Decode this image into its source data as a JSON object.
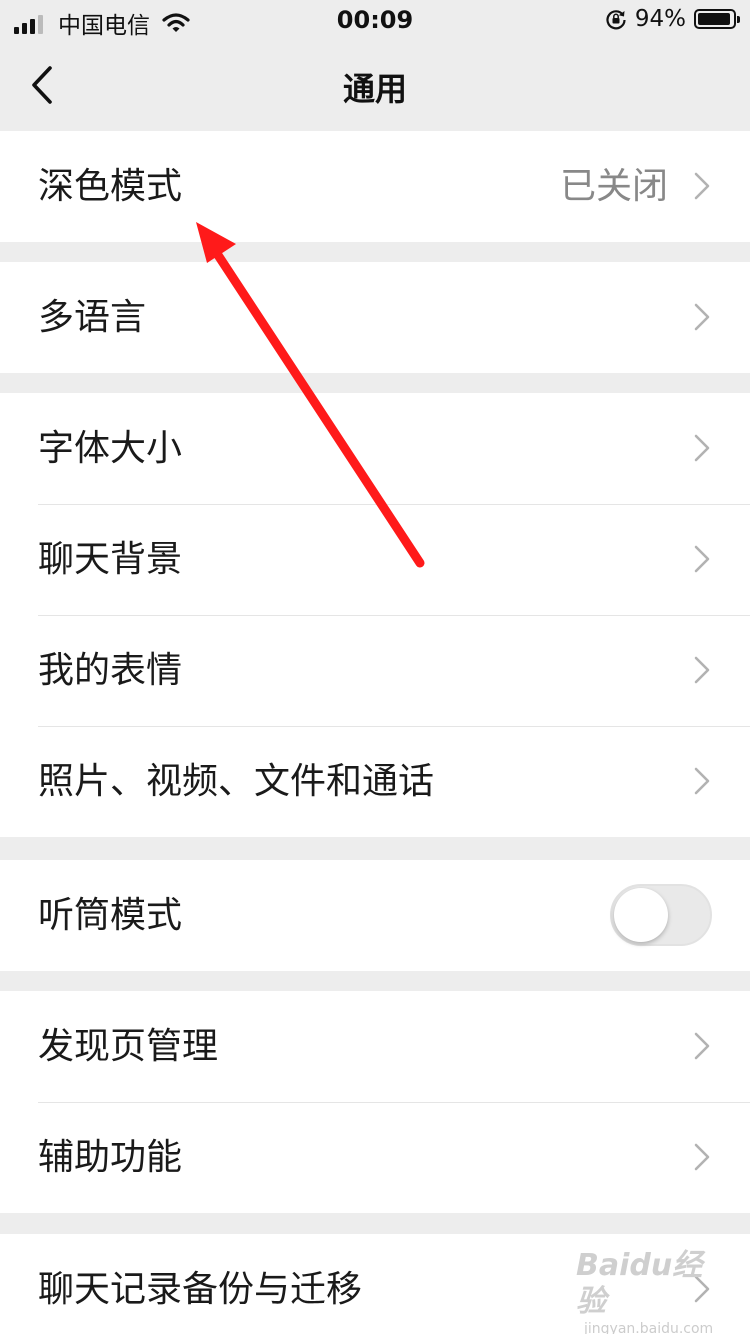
{
  "status_bar": {
    "carrier": "中国电信",
    "time": "00:09",
    "battery_percent": "94%",
    "battery_level": 0.94,
    "icons": [
      "signal-icon",
      "wifi-icon",
      "orientation-lock-icon",
      "battery-icon"
    ]
  },
  "nav": {
    "title": "通用",
    "back_icon": "back-chevron-icon"
  },
  "groups": [
    {
      "items": [
        {
          "label": "深色模式",
          "value": "已关闭",
          "control": "chevron"
        }
      ]
    },
    {
      "items": [
        {
          "label": "多语言",
          "control": "chevron"
        }
      ]
    },
    {
      "items": [
        {
          "label": "字体大小",
          "control": "chevron"
        },
        {
          "label": "聊天背景",
          "control": "chevron"
        },
        {
          "label": "我的表情",
          "control": "chevron"
        },
        {
          "label": "照片、视频、文件和通话",
          "control": "chevron"
        }
      ]
    },
    {
      "items": [
        {
          "label": "听筒模式",
          "control": "toggle",
          "toggle_on": false
        }
      ]
    },
    {
      "items": [
        {
          "label": "发现页管理",
          "control": "chevron"
        },
        {
          "label": "辅助功能",
          "control": "chevron"
        }
      ]
    },
    {
      "items": [
        {
          "label": "聊天记录备份与迁移",
          "control": "chevron"
        }
      ]
    }
  ],
  "annotation": {
    "type": "red-arrow",
    "color": "#ff1a1a",
    "points_to": "深色模式"
  },
  "watermark": {
    "brand": "Baidu经验",
    "url": "jingyan.baidu.com"
  },
  "colors": {
    "background": "#ededed",
    "cell_background": "#ffffff",
    "secondary_text": "#888888",
    "chevron": "#b2b2b2"
  }
}
